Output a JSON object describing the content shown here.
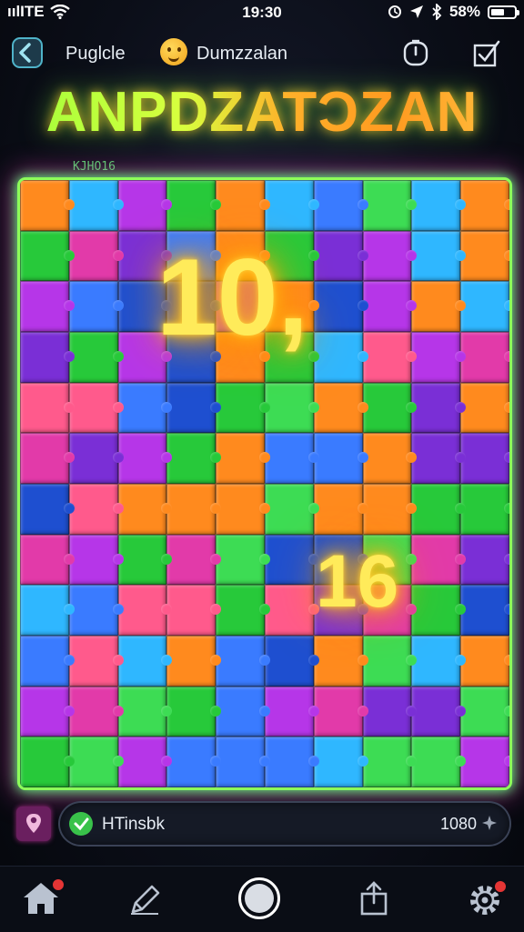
{
  "status_bar": {
    "carrier": "ıılITE",
    "time": "19:30",
    "battery": "58%",
    "battery_level": 0.58
  },
  "header": {
    "app_name": "Puglcle",
    "game_name": "Dumzzalan"
  },
  "title": "ANPDZATƆZAN",
  "small_label": "KJHO16",
  "board": {
    "rows": 12,
    "cols": 10,
    "palette": [
      "#3a7bff",
      "#b636e8",
      "#27c93a",
      "#ff5a8c",
      "#ff8a1e",
      "#2fb7ff",
      "#7a2fd6",
      "#e23aa9",
      "#3ddc54",
      "#1e4fd0"
    ],
    "glow_numbers": [
      "10,",
      "16"
    ],
    "accent": "#8dff5a"
  },
  "hint_bar": {
    "text": "HTinsbk",
    "score": "1080"
  },
  "nav": {
    "items": [
      "home",
      "draw",
      "center",
      "share",
      "settings"
    ]
  }
}
